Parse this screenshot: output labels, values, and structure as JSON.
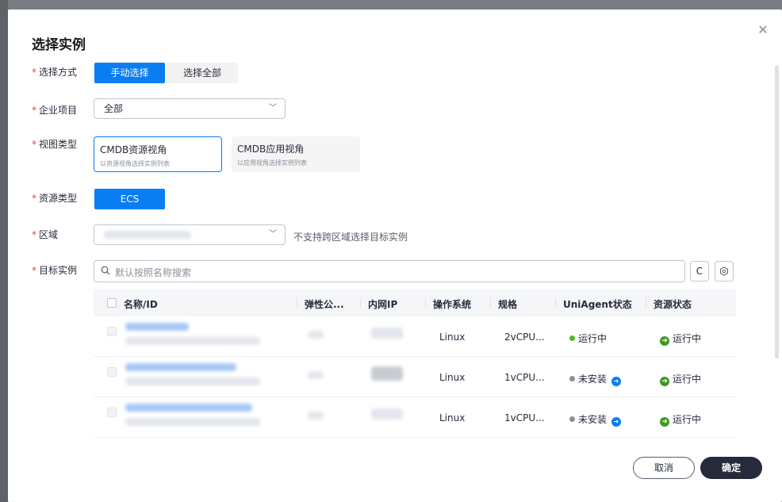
{
  "dialog": {
    "title": "选择实例",
    "close_icon": "close-icon"
  },
  "form": {
    "select_mode": {
      "label": "选择方式",
      "options": [
        "手动选择",
        "选择全部"
      ],
      "selected": "手动选择"
    },
    "enterprise_project": {
      "label": "企业项目",
      "value": "全部"
    },
    "view_type": {
      "label": "视图类型",
      "cards": [
        {
          "title": "CMDB资源视角",
          "subtitle": "以资源视角选择实例列表",
          "active": true
        },
        {
          "title": "CMDB应用视角",
          "subtitle": "以应用视角选择实例列表",
          "active": false
        }
      ]
    },
    "resource_type": {
      "label": "资源类型",
      "value": "ECS"
    },
    "region": {
      "label": "区域",
      "hint": "不支持跨区域选择目标实例"
    },
    "target_instance": {
      "label": "目标实例",
      "search_placeholder": "默认按照名称搜索",
      "refresh_icon": "refresh-icon",
      "settings_icon": "settings-icon"
    }
  },
  "table": {
    "headers": [
      "名称/ID",
      "弹性公...",
      "内网IP",
      "操作系统",
      "规格",
      "UniAgent状态",
      "资源状态"
    ],
    "rows": [
      {
        "os": "Linux",
        "spec": "2vCPU...",
        "agent_status": "运行中",
        "agent_color": "#50b52c",
        "resource_status": "运行中",
        "installable": false
      },
      {
        "os": "Linux",
        "spec": "1vCPU...",
        "agent_status": "未安装",
        "agent_color": "#8a8e99",
        "resource_status": "运行中",
        "installable": true
      },
      {
        "os": "Linux",
        "spec": "1vCPU...",
        "agent_status": "未安装",
        "agent_color": "#8a8e99",
        "resource_status": "运行中",
        "installable": true
      }
    ]
  },
  "footer": {
    "cancel_label": "取消",
    "ok_label": "确定"
  },
  "colors": {
    "primary": "#0a7df2",
    "required": "#e54545",
    "dark_button": "#252b3a",
    "running_green": "#3e9a1f"
  }
}
